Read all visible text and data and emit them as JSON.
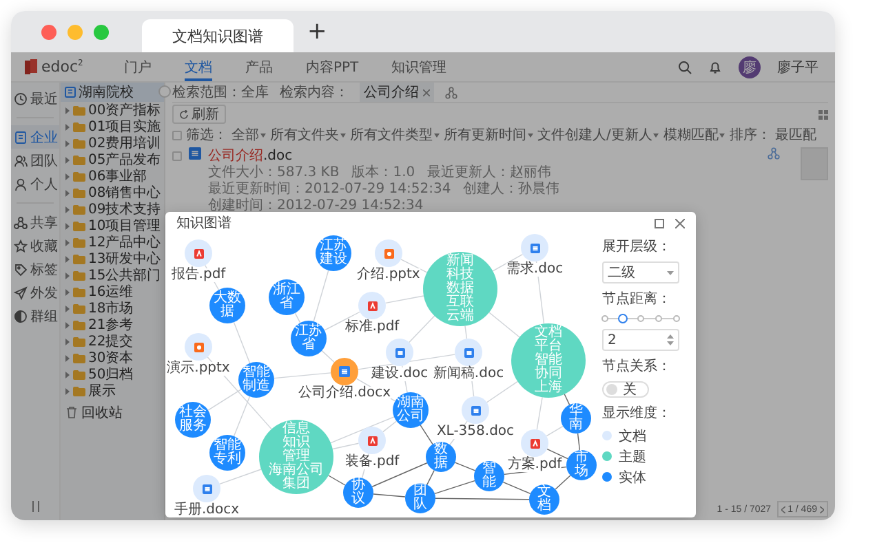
{
  "browser": {
    "tab_title": "文档知识图谱",
    "new_tab": "+"
  },
  "header": {
    "logo": "edoc$^{2}$",
    "nav": [
      {
        "label": "门户",
        "selected": false
      },
      {
        "label": "文档",
        "selected": true
      },
      {
        "label": "产品",
        "selected": false
      },
      {
        "label": "内容PPT",
        "selected": false
      },
      {
        "label": "知识管理",
        "selected": false
      }
    ],
    "avatar": "廖",
    "user": "廖子平"
  },
  "rail": {
    "groups": [
      [
        {
          "label": "最近",
          "kind": "clock",
          "selected": false
        }
      ],
      [
        {
          "label": "企业",
          "kind": "enterprise",
          "selected": true
        },
        {
          "label": "团队",
          "kind": "team",
          "selected": false
        },
        {
          "label": "个人",
          "kind": "person",
          "selected": false
        }
      ],
      [
        {
          "label": "共享",
          "kind": "share",
          "selected": false
        },
        {
          "label": "收藏",
          "kind": "star",
          "selected": false
        },
        {
          "label": "标签",
          "kind": "tag",
          "selected": false
        },
        {
          "label": "外发",
          "kind": "send",
          "selected": false
        },
        {
          "label": "群组",
          "kind": "group",
          "selected": false
        }
      ]
    ]
  },
  "tree": {
    "root": {
      "label": "湖南院校",
      "selected": true
    },
    "folders": [
      {
        "label": "00资产指标",
        "expanded": false
      },
      {
        "label": "01项目实施",
        "expanded": false
      },
      {
        "label": "02费用培训",
        "expanded": false
      },
      {
        "label": "05产品发布",
        "expanded": false
      },
      {
        "label": "06事业部",
        "expanded": false
      },
      {
        "label": "08销售中心",
        "expanded": false
      },
      {
        "label": "09技术支持",
        "expanded": false
      },
      {
        "label": "10项目管理",
        "expanded": false
      },
      {
        "label": "12产品中心",
        "expanded": false
      },
      {
        "label": "13研发中心",
        "expanded": false
      },
      {
        "label": "15公共部门",
        "expanded": false
      },
      {
        "label": "16运维",
        "expanded": false
      },
      {
        "label": "18市场",
        "expanded": false
      },
      {
        "label": "21参考",
        "expanded": false
      },
      {
        "label": "22提交",
        "expanded": false
      },
      {
        "label": "30资本",
        "expanded": false
      },
      {
        "label": "50归档",
        "expanded": false
      },
      {
        "label": "展示",
        "expanded": false
      }
    ],
    "recycle_bin": "回收站"
  },
  "search": {
    "scope": "检索范围：全库",
    "content_label": "检索内容：",
    "chips": [
      "公司介绍"
    ]
  },
  "toolbar": {
    "refresh": "刷新"
  },
  "filters": {
    "select_all": {
      "checked": false
    },
    "label": "筛选：",
    "dropdowns": [
      "全部",
      "所有文件夹",
      "所有文件类型",
      "所有更新时间",
      "文件创建人/更新人",
      "模糊匹配"
    ],
    "sort_label": "排序：",
    "sort": "最匹配"
  },
  "files": [
    {
      "name": "**公司介绍**.doc",
      "checked": false,
      "meta": [
        "文件大小：587.3 KB",
        "版本：1.0",
        "最近更新人：赵丽伟",
        "最近更新时间：2012-07-29 14:52:34",
        "创建人：孙晨伟",
        "创建时间：2012-07-29 14:52:34"
      ]
    }
  ],
  "pagination": {
    "range": "1 - 15 / 7027",
    "page": "1 / 469"
  },
  "modal": {
    "title": "知识图谱",
    "graph": {
      "nodes": [
        {
          "kind": "pdf",
          "label": "报告.pdf",
          "selected": false
        },
        {
          "kind": "entity",
          "label": "江苏建设",
          "selected": false
        },
        {
          "kind": "ppt",
          "label": "介绍.pptx",
          "selected": false
        },
        {
          "kind": "word",
          "label": "需求.doc",
          "selected": false
        },
        {
          "kind": "entity",
          "label": "大数据",
          "selected": false
        },
        {
          "kind": "entity",
          "label": "浙江省",
          "selected": false
        },
        {
          "kind": "pdf",
          "label": "标准.pdf",
          "selected": false
        },
        {
          "kind": "topic",
          "lines": [
            "新闻",
            "科技",
            "数据",
            "互联",
            "云端"
          ],
          "selected": false
        },
        {
          "kind": "ppt",
          "label": "演示.pptx",
          "selected": false
        },
        {
          "kind": "entity",
          "label": "江苏省",
          "selected": false
        },
        {
          "kind": "entity",
          "label": "智能制造",
          "selected": false
        },
        {
          "kind": "word",
          "label": "公司介绍.docx",
          "selected": true
        },
        {
          "kind": "word",
          "label": "建设.doc",
          "selected": false
        },
        {
          "kind": "word",
          "label": "新闻稿.doc",
          "selected": false
        },
        {
          "kind": "topic",
          "lines": [
            "文档",
            "平台",
            "智能",
            "协同",
            "上海"
          ],
          "selected": false
        },
        {
          "kind": "entity",
          "label": "社会服务",
          "selected": false
        },
        {
          "kind": "entity",
          "label": "湖南公司",
          "selected": false
        },
        {
          "kind": "word",
          "label": "XL-358.doc",
          "selected": false
        },
        {
          "kind": "entity",
          "label": "华南",
          "selected": false
        },
        {
          "kind": "entity",
          "label": "智能专利",
          "selected": false
        },
        {
          "kind": "topic",
          "lines": [
            "信息",
            "知识",
            "管理",
            "海南公司",
            "集团"
          ],
          "selected": false
        },
        {
          "kind": "pdf",
          "label": "装备.pdf",
          "selected": false
        },
        {
          "kind": "entity",
          "label": "数据",
          "selected": false
        },
        {
          "kind": "pdf",
          "label": "方案.pdf",
          "selected": false
        },
        {
          "kind": "entity",
          "label": "市场",
          "selected": false
        },
        {
          "kind": "entity",
          "label": "智能",
          "selected": false
        },
        {
          "kind": "word",
          "label": "手册.docx",
          "selected": false
        },
        {
          "kind": "entity",
          "label": "协议",
          "selected": false
        },
        {
          "kind": "entity",
          "label": "团队",
          "selected": false
        },
        {
          "kind": "entity",
          "label": "文档",
          "selected": false
        }
      ]
    },
    "controls": {
      "level_label": "展开层级：",
      "level_value": "二级",
      "distance_label": "节点距离：",
      "distance": {
        "level": 0.25
      },
      "distance_value": "2",
      "relation_label": "节点关系：",
      "relation": {
        "on": false,
        "label": "关"
      },
      "legend_label": "显示维度："
    },
    "legend": [
      {
        "kind": "document",
        "label": "文档",
        "color": "#dceafd"
      },
      {
        "kind": "topic",
        "label": "主题",
        "color": "#5fd8c2"
      },
      {
        "kind": "entity",
        "label": "实体",
        "color": "#1e8bff"
      }
    ]
  }
}
